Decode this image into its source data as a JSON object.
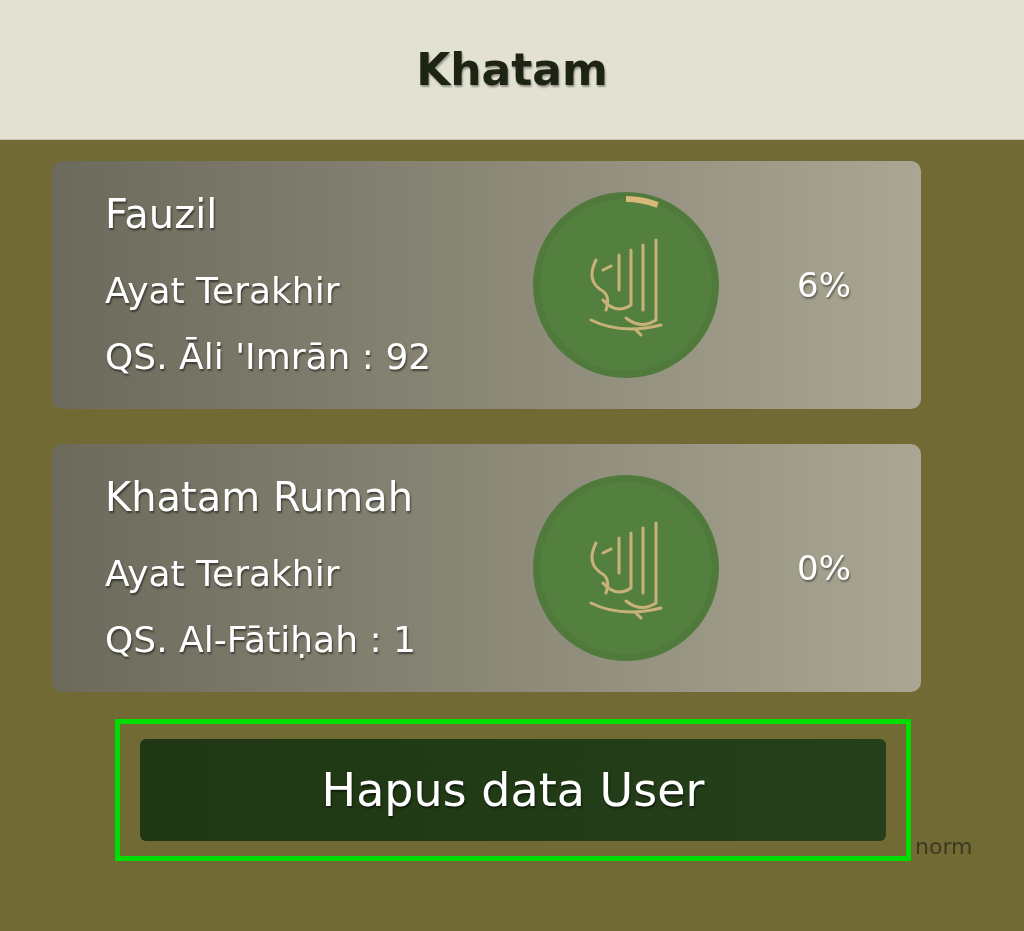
{
  "header": {
    "title": "Khatam"
  },
  "cards": [
    {
      "name": "Fauzil",
      "label": "Ayat Terakhir",
      "verse": "QS. Āli 'Imrān : 92",
      "percent": "6%",
      "level": 0.06
    },
    {
      "name": "Khatam Rumah",
      "label": "Ayat Terakhir",
      "verse": "QS. Al-Fātiḥah : 1",
      "percent": "0%",
      "level": 0
    }
  ],
  "button": {
    "label": "Hapus data User",
    "highlighted": true
  },
  "footer_text": "norm"
}
